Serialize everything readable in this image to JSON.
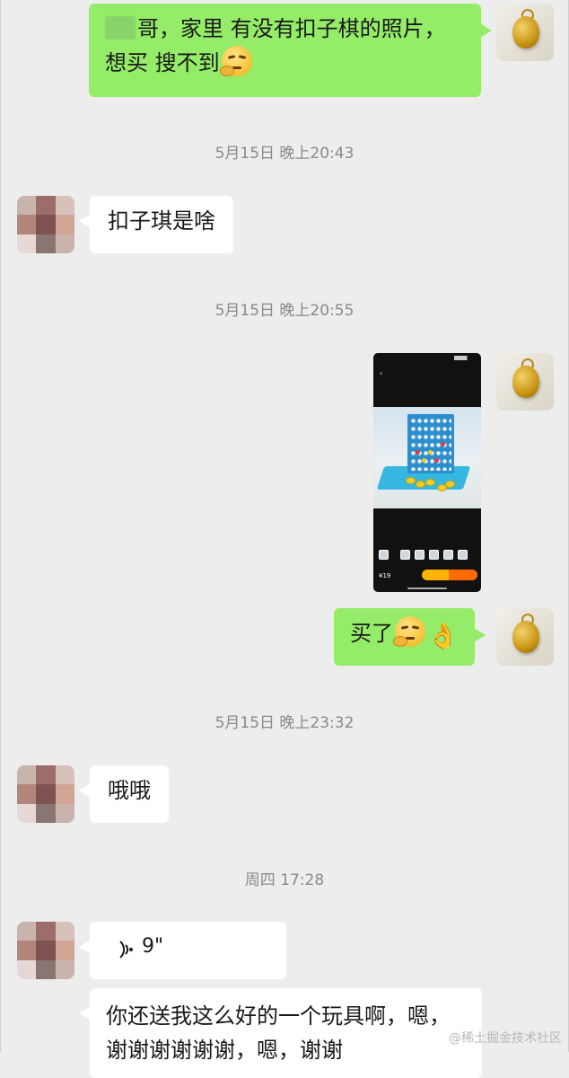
{
  "messages": [
    {
      "id": "m1",
      "sender": "me",
      "text_line1": "哥，家里 有没有扣子棋的照片，",
      "text_line2": "想买 搜不到"
    },
    {
      "id": "t1",
      "timestamp": "5月15日 晚上20:43"
    },
    {
      "id": "m2",
      "sender": "other",
      "text": "扣子琪是啥"
    },
    {
      "id": "t2",
      "timestamp": "5月15日 晚上20:55"
    },
    {
      "id": "m3",
      "sender": "me",
      "type": "image",
      "price": "¥19"
    },
    {
      "id": "m4",
      "sender": "me",
      "text": "买了"
    },
    {
      "id": "t3",
      "timestamp": "5月15日 晚上23:32"
    },
    {
      "id": "m5",
      "sender": "other",
      "text": "哦哦"
    },
    {
      "id": "t4",
      "timestamp": "周四 17:28"
    },
    {
      "id": "m6",
      "sender": "other",
      "type": "voice",
      "duration": "9\""
    },
    {
      "id": "m7",
      "sender": "other",
      "text_line1": "你还送我这么好的一个玩具啊，嗯，",
      "text_line2": "谢谢谢谢谢谢，嗯，谢谢"
    }
  ],
  "watermark": "@稀土掘金技术社区",
  "colors": {
    "background": "#ededed",
    "my_bubble": "#95ec69",
    "other_bubble": "#ffffff",
    "timestamp": "#8a8a8a"
  },
  "icons": {
    "emoji_thinking": "thinking-face-emoji",
    "emoji_ok": "ok-hand-emoji",
    "voice": "voice-wave-icon"
  }
}
